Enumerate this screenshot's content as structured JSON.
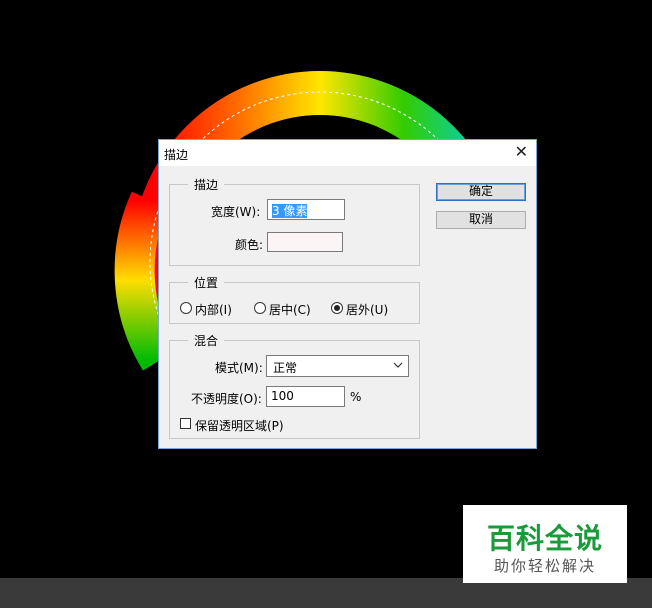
{
  "dialog": {
    "title": "描边",
    "stroke_group": {
      "legend": "描边",
      "width_label": "宽度(W):",
      "width_value": "3 像素",
      "color_label": "颜色:",
      "color_swatch": "#fbf6f5"
    },
    "position_group": {
      "legend": "位置",
      "options": [
        "内部(I)",
        "居中(C)",
        "居外(U)"
      ],
      "selected": "居外(U)"
    },
    "blend_group": {
      "legend": "混合",
      "mode_label": "模式(M):",
      "mode_value": "正常",
      "opacity_label": "不透明度(O):",
      "opacity_value": "100",
      "opacity_unit": "%",
      "preserve_label": "保留透明区域(P)",
      "preserve_checked": false
    },
    "ok_label": "确定",
    "cancel_label": "取消"
  },
  "watermark": {
    "title": "百科全说",
    "subtitle": "助你轻松解决"
  },
  "colors": {
    "background": "#000000",
    "ring_gradient": [
      "#ff0000",
      "#ff8000",
      "#ffff00",
      "#00c000",
      "#00c0c0"
    ],
    "brand_green": "#1a9a3a"
  }
}
